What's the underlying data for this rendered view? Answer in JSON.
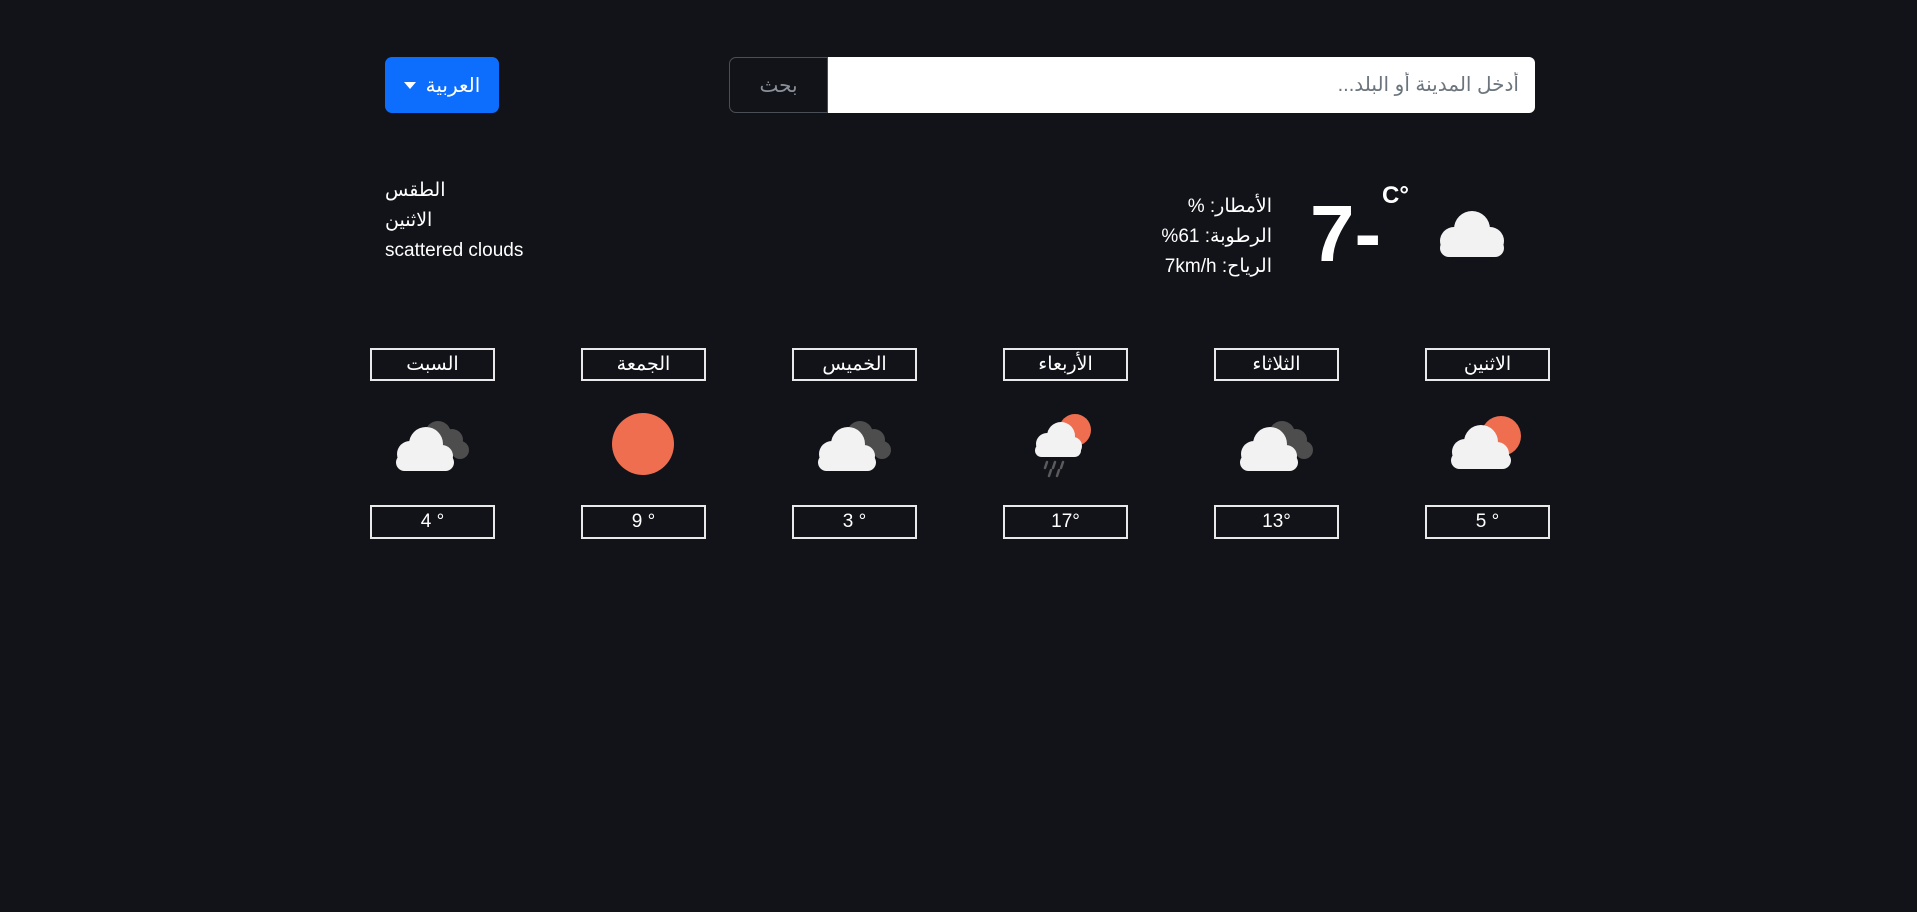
{
  "header": {
    "language_label": "العربية",
    "search_button_label": "بحث",
    "search_placeholder": "أدخل المدينة أو البلد..."
  },
  "current": {
    "label": "الطقس",
    "day": "الاثنين",
    "description": "scattered clouds",
    "rain": "الأمطار: %",
    "humidity": "الرطوبة: 61%",
    "wind": "الرياح: 7km/h",
    "temperature": "-7",
    "unit": "C°",
    "icon": "cloud-icon"
  },
  "forecast": [
    {
      "day": "الاثنين",
      "temp": "5 °",
      "icon": "partly-sunny-icon"
    },
    {
      "day": "الثلاثاء",
      "temp": "13°",
      "icon": "cloudy-icon"
    },
    {
      "day": "الأربعاء",
      "temp": "17°",
      "icon": "rain-sun-icon"
    },
    {
      "day": "الخميس",
      "temp": "3 °",
      "icon": "cloudy-icon"
    },
    {
      "day": "الجمعة",
      "temp": "9 °",
      "icon": "sun-icon"
    },
    {
      "day": "السبت",
      "temp": "4 °",
      "icon": "cloudy-icon"
    }
  ],
  "colors": {
    "background": "#111318",
    "accent": "#0d6efd",
    "sun": "#ee6e4f",
    "cloud_white": "#f2f2f2",
    "cloud_dark": "#4d4d4d"
  }
}
